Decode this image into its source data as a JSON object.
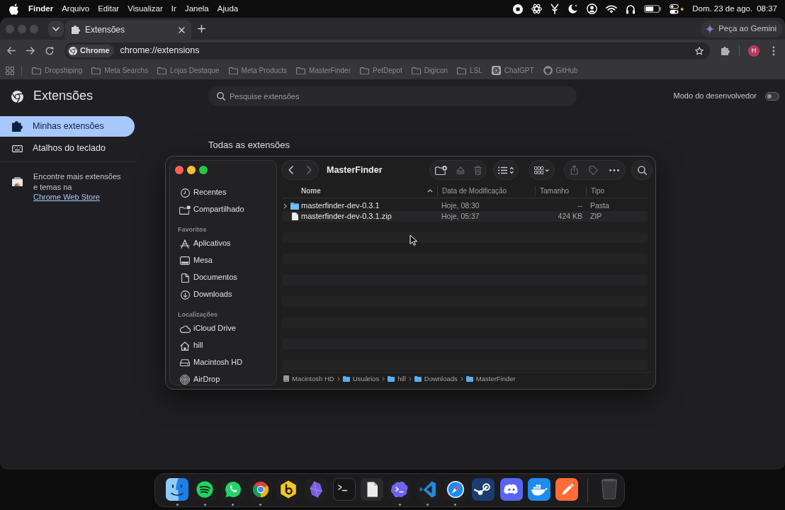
{
  "menu_bar": {
    "app": "Finder",
    "menus": [
      "Arquivo",
      "Editar",
      "Visualizar",
      "Ir",
      "Janela",
      "Ajuda"
    ],
    "date": "Dom. 23 de ago.",
    "time": "08:37"
  },
  "browser": {
    "tabs": [
      {
        "title": "Extensões",
        "selected": true
      }
    ],
    "gemini_button": "Peça ao Gemini",
    "omnibox": {
      "chip": "Chrome",
      "url": "chrome://extensions"
    },
    "profile_initial": "H",
    "bookmarks": [
      {
        "label": "Dropshiping",
        "kind": "folder"
      },
      {
        "label": "Meta Searchs",
        "kind": "folder"
      },
      {
        "label": "Lojas Destaque",
        "kind": "folder"
      },
      {
        "label": "Meta Products",
        "kind": "folder"
      },
      {
        "label": "MasterFinder",
        "kind": "folder"
      },
      {
        "label": "PetDepot",
        "kind": "folder"
      },
      {
        "label": "Digicon",
        "kind": "folder"
      },
      {
        "label": "LSL",
        "kind": "folder"
      },
      {
        "label": "ChatGPT",
        "kind": "site"
      },
      {
        "label": "GitHub",
        "kind": "site"
      }
    ]
  },
  "extensions_page": {
    "title": "Extensões",
    "search": {
      "placeholder": "Pesquise extensões"
    },
    "developer_mode": {
      "label": "Modo do desenvolvedor",
      "on": false
    },
    "sidebar": {
      "items": [
        {
          "label": "Minhas extensões",
          "selected": true
        },
        {
          "label": "Atalhos do teclado",
          "selected": false
        }
      ],
      "promo": {
        "text": "Encontre mais extensões e temas na",
        "link": "Chrome Web Store"
      }
    },
    "heading": "Todas as extensões"
  },
  "finder": {
    "title": "MasterFinder",
    "nav": [
      {
        "disabled": false
      },
      {
        "disabled": true
      }
    ],
    "toolbar": [
      {
        "disabled": false
      },
      {
        "disabled": true
      },
      {
        "disabled": true
      },
      {
        "disabled": false
      },
      {
        "disabled": false
      },
      {
        "disabled": true
      },
      {
        "disabled": true
      },
      {
        "disabled": false
      },
      {
        "disabled": false
      }
    ],
    "sidebar": {
      "sections": [
        {
          "items": [
            {
              "label": "Recentes",
              "selected": false
            },
            {
              "label": "Compartilhado",
              "selected": false
            }
          ]
        },
        {
          "heading": "Favoritos",
          "items": [
            {
              "label": "Aplicativos",
              "selected": false
            },
            {
              "label": "Mesa",
              "selected": false
            },
            {
              "label": "Documentos",
              "selected": false
            },
            {
              "label": "Downloads",
              "selected": false
            }
          ]
        },
        {
          "heading": "Localizações",
          "items": [
            {
              "label": "iCloud Drive",
              "selected": false
            },
            {
              "label": "hill",
              "selected": false
            },
            {
              "label": "Macintosh HD",
              "selected": false
            },
            {
              "label": "AirDrop",
              "selected": false
            }
          ]
        }
      ]
    },
    "columns": [
      {
        "label": "Nome",
        "sorted": true
      },
      {
        "label": "Data de Modificação",
        "sorted": false
      },
      {
        "label": "Tamanho",
        "sorted": false
      },
      {
        "label": "Tipo",
        "sorted": false
      }
    ],
    "rows": [
      {
        "kind": "folder",
        "name": "masterfinder-dev-0.3.1",
        "expanded": false,
        "modified": "Hoje, 08:30",
        "size": "--",
        "type": "Pasta",
        "selected": false
      },
      {
        "kind": "file",
        "name": "masterfinder-dev-0.3.1.zip",
        "modified": "Hoje, 05:37",
        "size": "424 KB",
        "type": "ZIP",
        "selected": false
      }
    ],
    "path": [
      {
        "label": "Macintosh HD",
        "kind": "disk"
      },
      {
        "label": "Usuários",
        "kind": "folder"
      },
      {
        "label": "hill",
        "kind": "folder"
      },
      {
        "label": "Downloads",
        "kind": "folder"
      },
      {
        "label": "MasterFinder",
        "kind": "folder"
      }
    ]
  },
  "dock": {
    "apps": [
      {
        "running": true
      },
      {
        "running": true
      },
      {
        "running": true
      },
      {
        "running": true
      },
      {
        "running": false
      },
      {
        "running": false
      },
      {
        "running": false
      },
      {
        "running": false
      },
      {
        "running": true
      },
      {
        "running": true
      },
      {
        "running": true
      },
      {
        "running": false
      },
      {
        "running": false
      },
      {
        "running": false
      },
      {
        "running": false
      }
    ]
  }
}
